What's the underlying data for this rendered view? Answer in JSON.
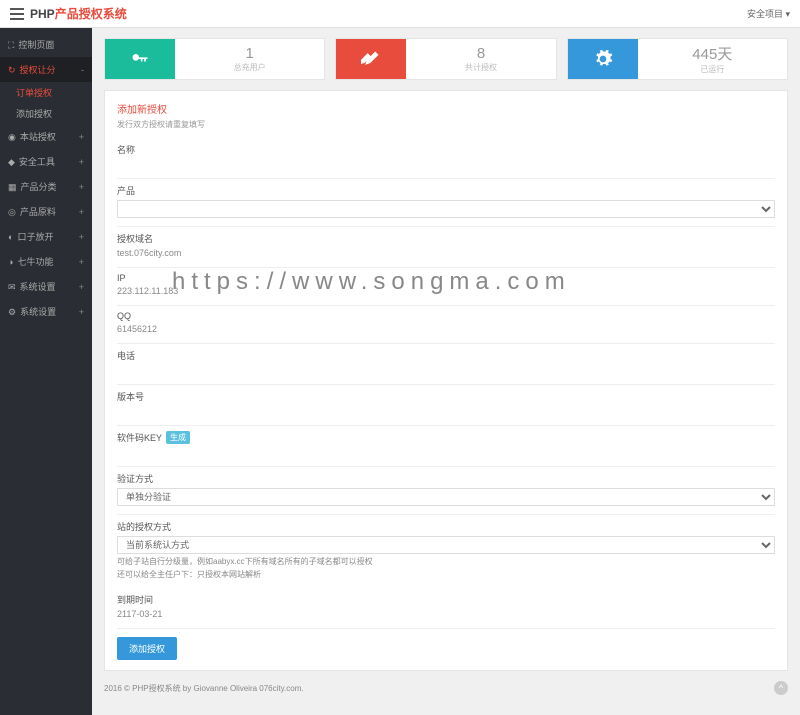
{
  "brand": {
    "prefix": "PHP",
    "suffix": "产品授权系统"
  },
  "topbar": {
    "user": "安全项目"
  },
  "sidebar": {
    "items": [
      {
        "label": "控制页面",
        "icon": "⛶"
      },
      {
        "label": "授权让分",
        "icon": "↻",
        "subs": [
          "订单授权",
          "添加授权"
        ]
      },
      {
        "label": "本站授权",
        "icon": "◉"
      },
      {
        "label": "安全工具",
        "icon": "◆"
      },
      {
        "label": "产品分类",
        "icon": "▦"
      },
      {
        "label": "产品原料",
        "icon": "◎"
      },
      {
        "label": "口子放开",
        "icon": "◐"
      },
      {
        "label": "七牛功能",
        "icon": "◑"
      },
      {
        "label": "系统设置",
        "icon": "✉"
      },
      {
        "label": "系统设置",
        "icon": "⚙"
      }
    ]
  },
  "stats": [
    {
      "num": "",
      "label": "",
      "color": "c-teal",
      "icon": "key"
    },
    {
      "num": "1",
      "label": "总充用户",
      "color": "",
      "icon": ""
    },
    {
      "num": "",
      "label": "",
      "color": "c-red",
      "icon": "tag"
    },
    {
      "num": "8",
      "label": "共计授权",
      "color": "",
      "icon": ""
    },
    {
      "num": "",
      "label": "",
      "color": "c-blue",
      "icon": "gear"
    },
    {
      "num": "445天",
      "label": "已运行",
      "color": "",
      "icon": ""
    }
  ],
  "form": {
    "title": "添加新授权",
    "subtitle": "发行双方授权请重复填写",
    "fields": {
      "name_label": "名称",
      "product_label": "产品",
      "domain_label": "授权域名",
      "domain_value": "test.076city.com",
      "ip_label": "IP",
      "ip_value": "223.112.11.183",
      "qq_label": "QQ",
      "qq_value": "61456212",
      "phone_label": "电话",
      "version_label": "版本号",
      "key_label": "软件码KEY",
      "key_badge": "生成",
      "verify_label": "验证方式",
      "verify_value": "单独分验证",
      "auth_label": "站的授权方式",
      "auth_value": "当前系统认方式",
      "tip1": "可给子站自行分级量，例如aabyx.cc下所有域名所有的子域名都可以授权",
      "tip2": "还可以给全主任户下：只授权本网站解析",
      "date_label": "到期时间",
      "date_value": "2117-03-21",
      "submit": "添加授权"
    }
  },
  "footer": {
    "text": "2016 © PHP授权系统 by Giovanne Oliveira 076city.com."
  },
  "watermark": "https://www.songma.com"
}
